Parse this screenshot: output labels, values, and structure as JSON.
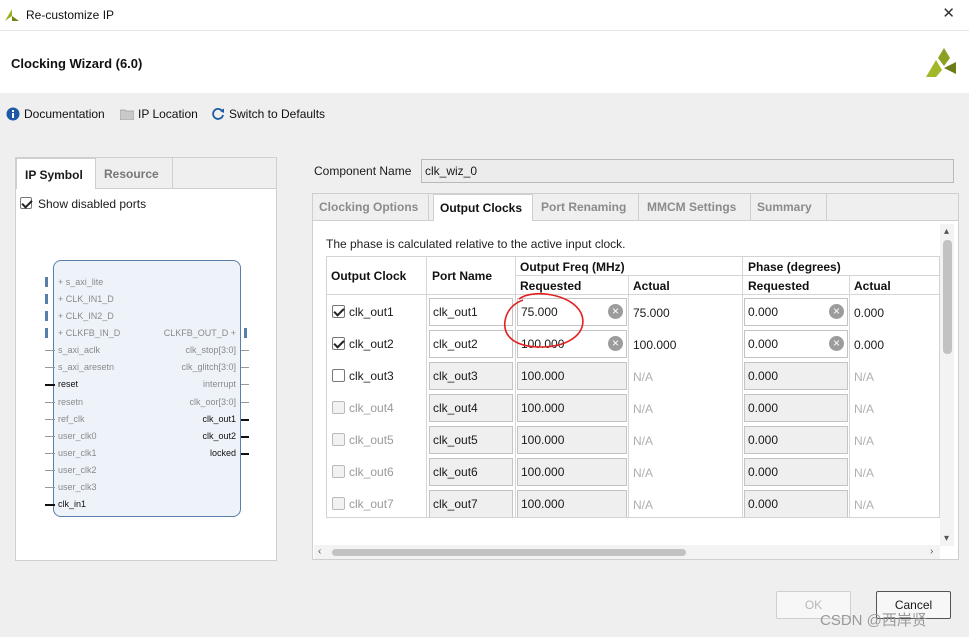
{
  "window": {
    "title": "Re-customize IP",
    "close_glyph": "✕"
  },
  "header": {
    "title": "Clocking Wizard (6.0)"
  },
  "toolbar": {
    "documentation": "Documentation",
    "ip_location": "IP Location",
    "switch_defaults": "Switch to Defaults"
  },
  "left_panel": {
    "tabs": [
      "IP Symbol",
      "Resource"
    ],
    "show_disabled_ports": "Show disabled ports",
    "left_pins": [
      {
        "label": "+ s_axi_lite"
      },
      {
        "label": "+ CLK_IN1_D"
      },
      {
        "label": "+ CLK_IN2_D"
      },
      {
        "label": "+ CLKFB_IN_D"
      },
      {
        "label": "s_axi_aclk"
      },
      {
        "label": "s_axi_aresetn"
      },
      {
        "label": "reset"
      },
      {
        "label": "resetn"
      },
      {
        "label": "ref_clk"
      },
      {
        "label": "user_clk0"
      },
      {
        "label": "user_clk1"
      },
      {
        "label": "user_clk2"
      },
      {
        "label": "user_clk3"
      },
      {
        "label": "clk_in1"
      }
    ],
    "right_pins": [
      {
        "label": "CLKFB_OUT_D +"
      },
      {
        "label": "clk_stop[3:0]"
      },
      {
        "label": "clk_glitch[3:0]"
      },
      {
        "label": "interrupt"
      },
      {
        "label": "clk_oor[3:0]"
      },
      {
        "label": "clk_out1"
      },
      {
        "label": "clk_out2"
      },
      {
        "label": "locked"
      }
    ]
  },
  "component": {
    "label": "Component Name",
    "value": "clk_wiz_0"
  },
  "tabs": [
    "Clocking Options",
    "Output Clocks",
    "Port Renaming",
    "MMCM Settings",
    "Summary"
  ],
  "active_tab": "Output Clocks",
  "note": "The phase is calculated relative to the active input clock.",
  "table": {
    "headers": {
      "output_clock": "Output Clock",
      "port_name": "Port Name",
      "output_freq": "Output Freq (MHz)",
      "phase": "Phase (degrees)",
      "requested": "Requested",
      "actual": "Actual"
    },
    "rows": [
      {
        "name": "clk_out1",
        "port": "clk_out1",
        "freq_req": "75.000",
        "freq_act": "75.000",
        "phase_req": "0.000",
        "phase_act": "0.000",
        "checked": true,
        "enabled": true
      },
      {
        "name": "clk_out2",
        "port": "clk_out2",
        "freq_req": "100.000",
        "freq_act": "100.000",
        "phase_req": "0.000",
        "phase_act": "0.000",
        "checked": true,
        "enabled": true
      },
      {
        "name": "clk_out3",
        "port": "clk_out3",
        "freq_req": "100.000",
        "freq_act": "N/A",
        "phase_req": "0.000",
        "phase_act": "N/A",
        "checked": false,
        "enabled": true
      },
      {
        "name": "clk_out4",
        "port": "clk_out4",
        "freq_req": "100.000",
        "freq_act": "N/A",
        "phase_req": "0.000",
        "phase_act": "N/A",
        "checked": false,
        "enabled": false
      },
      {
        "name": "clk_out5",
        "port": "clk_out5",
        "freq_req": "100.000",
        "freq_act": "N/A",
        "phase_req": "0.000",
        "phase_act": "N/A",
        "checked": false,
        "enabled": false
      },
      {
        "name": "clk_out6",
        "port": "clk_out6",
        "freq_req": "100.000",
        "freq_act": "N/A",
        "phase_req": "0.000",
        "phase_act": "N/A",
        "checked": false,
        "enabled": false
      },
      {
        "name": "clk_out7",
        "port": "clk_out7",
        "freq_req": "100.000",
        "freq_act": "N/A",
        "phase_req": "0.000",
        "phase_act": "N/A",
        "checked": false,
        "enabled": false
      }
    ]
  },
  "buttons": {
    "ok": "OK",
    "cancel": "Cancel"
  },
  "watermark": "CSDN @西岸贤",
  "colors": {
    "accent_logo": "#a3b829",
    "annotation": "#e02020"
  }
}
